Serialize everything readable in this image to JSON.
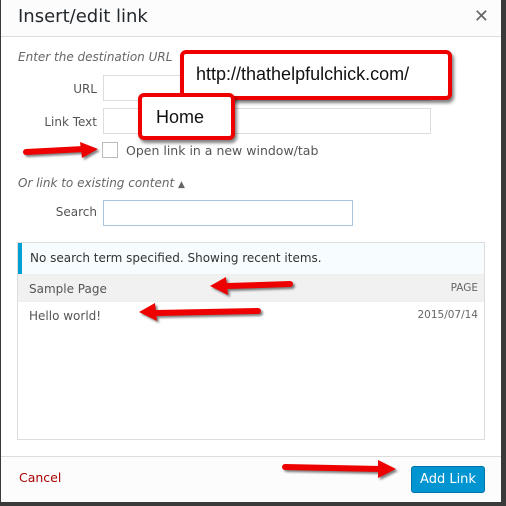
{
  "dialog": {
    "title": "Insert/edit link",
    "close_icon": "close-icon"
  },
  "url_section": {
    "heading": "Enter the destination URL",
    "url_label": "URL",
    "url_value": "",
    "link_text_label": "Link Text",
    "link_text_value": "",
    "new_tab_label": "Open link in a new window/tab",
    "new_tab_checked": false
  },
  "existing": {
    "toggle_label": "Or link to existing content",
    "toggle_icon": "triangle-up-icon",
    "search_label": "Search",
    "search_value": "",
    "notice": "No search term specified. Showing recent items.",
    "items": [
      {
        "title": "Sample Page",
        "info": "PAGE"
      },
      {
        "title": "Hello world!",
        "info": "2015/07/14"
      }
    ]
  },
  "footer": {
    "cancel_label": "Cancel",
    "submit_label": "Add Link"
  },
  "annotations": {
    "url_callout": "http://thathelpfulchick.com/",
    "text_callout": "Home",
    "color": "#e00000"
  }
}
